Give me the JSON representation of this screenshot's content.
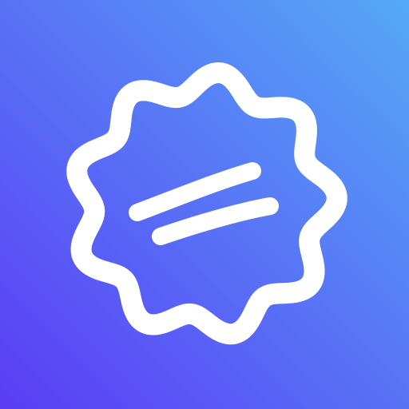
{
  "icon": {
    "name": "badge-with-lines-icon",
    "gradient_start": "#5B3CF5",
    "gradient_end": "#55A9F7",
    "stroke_color": "#FFFFFF"
  }
}
